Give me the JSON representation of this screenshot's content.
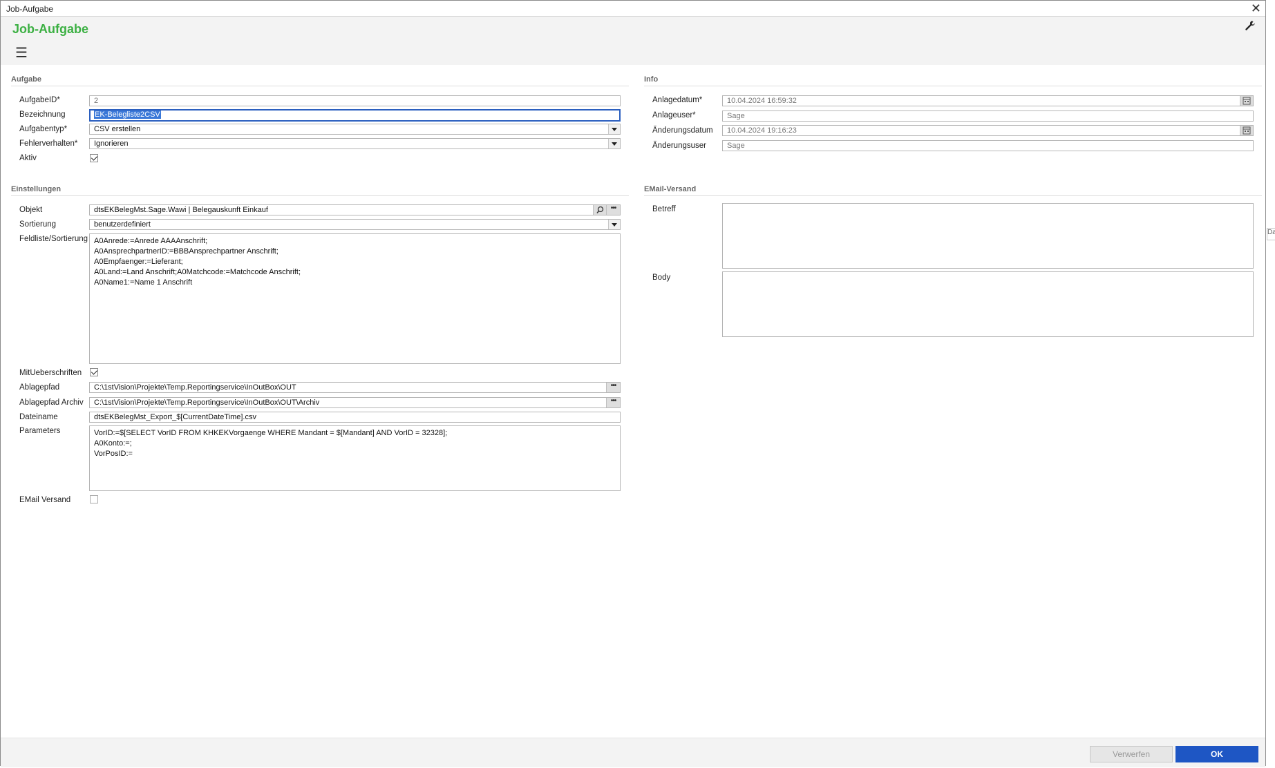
{
  "window": {
    "title": "Job-Aufgabe",
    "close_glyph": "✕"
  },
  "header": {
    "app_title": "Job-Aufgabe",
    "menu_glyph": "☰"
  },
  "sections": {
    "aufgabe": "Aufgabe",
    "info": "Info",
    "einstellungen": "Einstellungen",
    "email": "EMail-Versand"
  },
  "aufgabe": {
    "aufgabeid": {
      "label": "AufgabeID*",
      "value": "2"
    },
    "bezeichnung": {
      "label": "Bezeichnung",
      "value": "EK-Belegliste2CSV"
    },
    "aufgabentyp": {
      "label": "Aufgabentyp*",
      "value": "CSV erstellen"
    },
    "fehlerverhalten": {
      "label": "Fehlerverhalten*",
      "value": "Ignorieren"
    },
    "aktiv": {
      "label": "Aktiv",
      "checked": true
    }
  },
  "info": {
    "anlagedatum": {
      "label": "Anlagedatum*",
      "value": "10.04.2024 16:59:32"
    },
    "anlageuser": {
      "label": "Anlageuser*",
      "value": "Sage"
    },
    "aenderungsdatum": {
      "label": "Änderungsdatum",
      "value": "10.04.2024 19:16:23"
    },
    "aenderungsuser": {
      "label": "Änderungsuser",
      "value": "Sage"
    }
  },
  "einstellungen": {
    "objekt": {
      "label": "Objekt",
      "value": "dtsEKBelegMst.Sage.Wawi  |  Belegauskunft Einkauf"
    },
    "sortierung": {
      "label": "Sortierung",
      "value": "benutzerdefiniert"
    },
    "feldliste": {
      "label": "Feldliste/Sortierung",
      "lines": [
        "A0Anrede:=Anrede AAAAnschrift;",
        "A0AnsprechpartnerID:=BBBAnsprechpartner Anschrift;",
        "A0Empfaenger:=Lieferant;",
        "A0Land:=Land Anschrift;A0Matchcode:=Matchcode Anschrift;",
        "A0Name1:=Name 1 Anschrift"
      ]
    },
    "mitueberschriften": {
      "label": "MitUeberschriften",
      "checked": true
    },
    "ablagepfad": {
      "label": "Ablagepfad",
      "value": "C:\\1stVision\\Projekte\\Temp.Reportingservice\\InOutBox\\OUT"
    },
    "ablagepfad_archiv": {
      "label": "Ablagepfad Archiv",
      "value": "C:\\1stVision\\Projekte\\Temp.Reportingservice\\InOutBox\\OUT\\Archiv"
    },
    "dateiname": {
      "label": "Dateiname",
      "value": "dtsEKBelegMst_Export_$[CurrentDateTime].csv"
    },
    "parameters": {
      "label": "Parameters",
      "lines": [
        "VorID:=$[SELECT VorID FROM KHKEKVorgaenge WHERE Mandant = $[Mandant] AND VorID = 32328];",
        "A0Konto:=;",
        "VorPosID:="
      ]
    },
    "email_versand": {
      "label": "EMail Versand",
      "checked": false
    }
  },
  "email": {
    "betreff": {
      "label": "Betreff",
      "value": ""
    },
    "body": {
      "label": "Body",
      "value": ""
    }
  },
  "footer": {
    "discard_label": "Verwerfen",
    "ok_label": "OK"
  },
  "side_strip": {
    "text": "Da"
  },
  "icons": {
    "menu": "hamburger-icon",
    "wrench": "wrench-icon",
    "close": "close-icon",
    "search": "search-icon",
    "more": "ellipsis-icon",
    "calendar": "calendar-icon",
    "dropdown": "chevron-down-icon"
  },
  "colors": {
    "accent_green": "#3cb043",
    "primary_blue": "#1e56c4",
    "selection_blue": "#3a78d8"
  }
}
